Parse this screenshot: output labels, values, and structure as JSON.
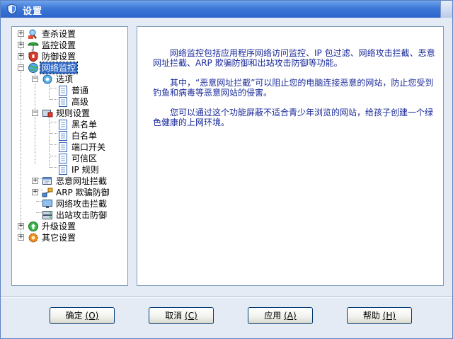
{
  "window": {
    "title": "设置"
  },
  "tree": {
    "items": [
      {
        "label": "查杀设置",
        "icon": "scan-shield-icon"
      },
      {
        "label": "监控设置",
        "icon": "umbrella-icon"
      },
      {
        "label": "防御设置",
        "icon": "shield-icon"
      },
      {
        "label": "网络监控",
        "icon": "network-globe-icon",
        "selected": true
      },
      {
        "label": "选项",
        "icon": "options-gear-icon"
      },
      {
        "label": "普通",
        "icon": "page-icon"
      },
      {
        "label": "高级",
        "icon": "page-icon"
      },
      {
        "label": "规则设置",
        "icon": "rules-icon"
      },
      {
        "label": "黑名单",
        "icon": "page-icon"
      },
      {
        "label": "白名单",
        "icon": "page-icon"
      },
      {
        "label": "端口开关",
        "icon": "page-icon"
      },
      {
        "label": "可信区",
        "icon": "page-icon"
      },
      {
        "label": "IP 规则",
        "icon": "page-icon"
      },
      {
        "label": "恶意网址拦截",
        "icon": "url-block-icon"
      },
      {
        "label": "ARP 欺骗防御",
        "icon": "arp-icon"
      },
      {
        "label": "网络攻击拦截",
        "icon": "monitor-icon"
      },
      {
        "label": "出站攻击防御",
        "icon": "server-icon"
      },
      {
        "label": "升级设置",
        "icon": "upgrade-icon"
      },
      {
        "label": "其它设置",
        "icon": "gear-icon"
      }
    ]
  },
  "description": {
    "p1": "网络监控包括应用程序网络访问监控、IP 包过滤、网络攻击拦截、恶意网址拦截、ARP 欺骗防御和出站攻击防御等功能。",
    "p2": "其中，“恶意网址拦截”可以阻止您的电脑连接恶意的网站，防止您受到钓鱼和病毒等恶意网站的侵害。",
    "p3": "您可以通过这个功能屏蔽不适合青少年浏览的网站，给孩子创建一个绿色健康的上网环境。"
  },
  "buttons": {
    "ok": "确定",
    "ok_key": "(O)",
    "cancel": "取消",
    "cancel_key": "(C)",
    "apply": "应用",
    "apply_key": "(A)",
    "help": "帮助",
    "help_key": "(H)"
  }
}
